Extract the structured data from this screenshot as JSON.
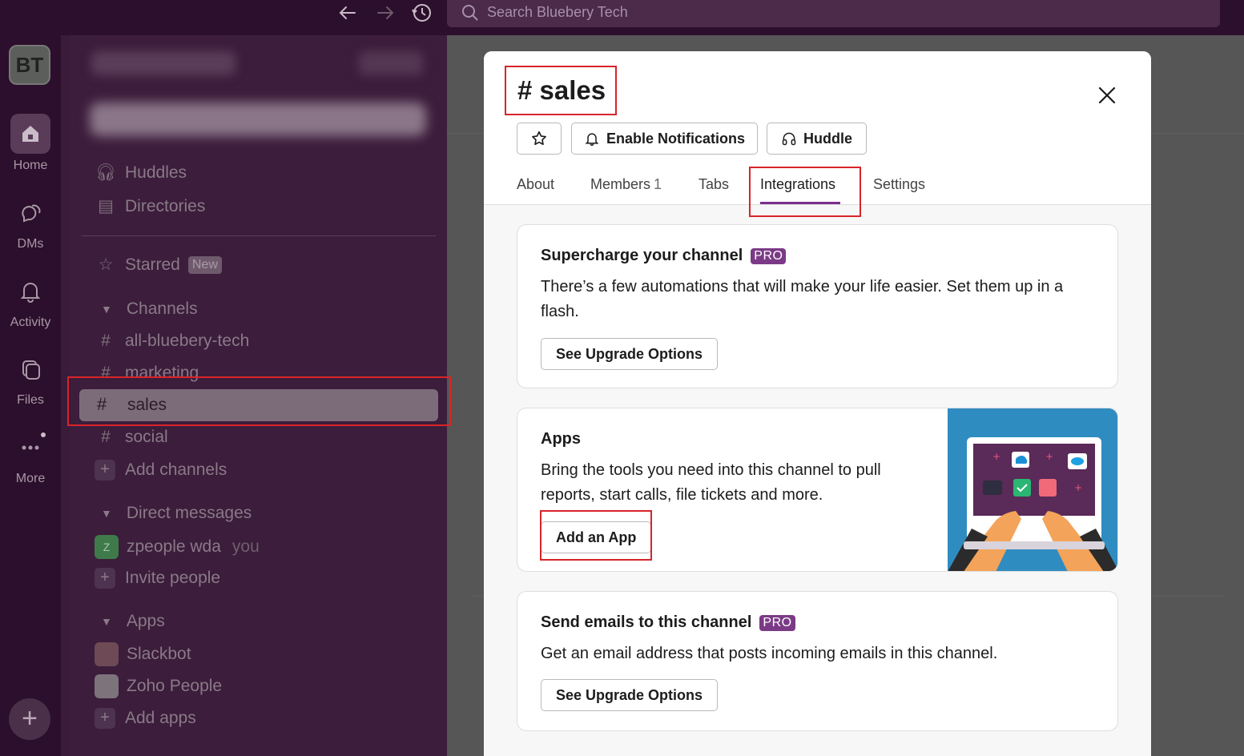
{
  "search": {
    "placeholder": "Search Bluebery Tech"
  },
  "workspace": {
    "initials": "BT"
  },
  "rail": {
    "items": [
      {
        "label": "Home",
        "icon": "home-icon"
      },
      {
        "label": "DMs",
        "icon": "dms-icon"
      },
      {
        "label": "Activity",
        "icon": "bell-icon"
      },
      {
        "label": "Files",
        "icon": "files-icon"
      },
      {
        "label": "More",
        "icon": "more-icon"
      }
    ],
    "add_label": "+"
  },
  "sidebar": {
    "huddles": "Huddles",
    "directories": "Directories",
    "starred": "Starred",
    "starred_badge": "New",
    "channels_header": "Channels",
    "channels": [
      "all-bluebery-tech",
      "marketing",
      "sales",
      "social"
    ],
    "add_channels": "Add channels",
    "dm_header": "Direct messages",
    "dm_user": "zpeople wda",
    "dm_user_initial": "Z",
    "dm_you": "you",
    "invite": "Invite people",
    "apps_header": "Apps",
    "apps": [
      "Slackbot",
      "Zoho People"
    ],
    "add_apps": "Add apps"
  },
  "modal": {
    "hash": "#",
    "title": "sales",
    "enable_notifications": "Enable Notifications",
    "huddle": "Huddle",
    "tabs": {
      "about": "About",
      "members": "Members",
      "members_count": "1",
      "tabs": "Tabs",
      "integrations": "Integrations",
      "settings": "Settings"
    },
    "cards": {
      "supercharge_title": "Supercharge your channel",
      "supercharge_badge": "PRO",
      "supercharge_text": "There’s a few automations that will make your life easier. Set them up in a flash.",
      "supercharge_button": "See Upgrade Options",
      "apps_title": "Apps",
      "apps_text": "Bring the tools you need into this channel to pull reports, start calls, file tickets and more.",
      "apps_button": "Add an App",
      "email_title": "Send emails to this channel",
      "email_badge": "PRO",
      "email_text": "Get an email address that posts incoming emails in this channel.",
      "email_button": "See Upgrade Options"
    }
  },
  "colors": {
    "rail_bg": "#2c0f2c",
    "sidebar_bg": "#3c1d3b",
    "accent_purple": "#7a2e8c",
    "annotation_red": "#d8242a"
  }
}
